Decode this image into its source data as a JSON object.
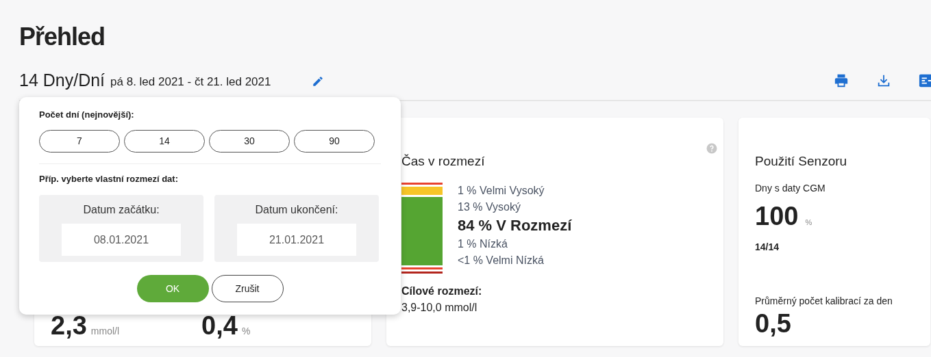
{
  "page_title": "Přehled",
  "period": {
    "days": "14 Dny/Dní",
    "range": "pá 8. led 2021 - čt 21. led 2021"
  },
  "toolbar": {
    "icons": [
      {
        "kind": "print"
      },
      {
        "kind": "download"
      },
      {
        "kind": "export"
      }
    ]
  },
  "popover": {
    "days_label": "Počet dní (nejnovější):",
    "day_options": [
      {
        "label": "7",
        "selected": false
      },
      {
        "label": "14",
        "selected": false
      },
      {
        "label": "30",
        "selected": false
      },
      {
        "label": "90",
        "selected": false
      }
    ],
    "custom_label": "Příp. vyberte vlastní rozmezí dat:",
    "start": {
      "label": "Datum začátku:",
      "value": "08.01.2021"
    },
    "end": {
      "label": "Datum ukončení:",
      "value": "21.01.2021"
    },
    "ok": "OK",
    "cancel": "Zrušit"
  },
  "left_card": {
    "metrics": [
      {
        "value": "2,3",
        "unit": "mmol/l"
      },
      {
        "value": "0,4",
        "unit": "%"
      }
    ]
  },
  "time_in_range": {
    "title": "Čas v rozmezí",
    "bar_segments": [
      {
        "color": "#e8432e"
      },
      {
        "color": "#f6c528"
      },
      {
        "color": "#55a532"
      },
      {
        "color": "#e8432e"
      },
      {
        "color": "#b3261e"
      }
    ],
    "ranges": [
      {
        "text": "1 % Velmi Vysoký",
        "emphasized": false
      },
      {
        "text": "13 % Vysoký",
        "emphasized": false
      },
      {
        "text": "84 % V Rozmezí",
        "emphasized": true
      },
      {
        "text": "1 % Nízká",
        "emphasized": false
      },
      {
        "text": "<1 % Velmi Nízká",
        "emphasized": false
      }
    ],
    "target_label": "Cílové rozmezí:",
    "target_value": "3,9-10,0 mmol/l"
  },
  "sensor": {
    "title": "Použití Senzoru",
    "days_label": "Dny s daty CGM",
    "days_value": "100",
    "days_unit": "%",
    "days_count": "14/14",
    "calib_label": "Průměrný počet kalibrací za den",
    "calib_value": "0,5"
  }
}
